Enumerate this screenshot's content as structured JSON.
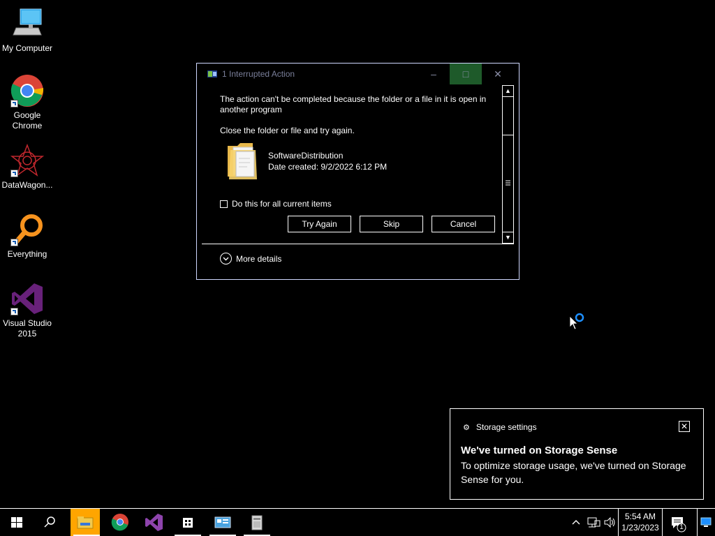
{
  "desktop": {
    "icons": [
      {
        "label": "My Computer"
      },
      {
        "label": "Google Chrome"
      },
      {
        "label": "DataWagon..."
      },
      {
        "label": "Everything"
      },
      {
        "label": "Visual Studio 2015"
      }
    ]
  },
  "dialog": {
    "title": "1 Interrupted Action",
    "message": "The action can't be completed because the folder or a file in it is open in another program",
    "instruction": "Close the folder or file and try again.",
    "file_name": "SoftwareDistribution",
    "file_date": "Date created: 9/2/2022 6:12 PM",
    "checkbox_label": "Do this for all current items",
    "checkbox_checked": false,
    "buttons": {
      "try_again": "Try Again",
      "skip": "Skip",
      "cancel": "Cancel"
    },
    "more_details": "More details"
  },
  "toast": {
    "header": "Storage settings",
    "title": "We've turned on Storage Sense",
    "body": "To optimize storage usage, we've turned on Storage Sense for you."
  },
  "taskbar": {
    "time": "5:54 AM",
    "date": "1/23/2023",
    "notification_count": "1",
    "items": [
      "start-icon",
      "search-icon",
      "file-explorer-icon",
      "chrome-icon",
      "visual-studio-icon",
      "store-icon",
      "control-panel-icon",
      "installer-icon"
    ]
  },
  "colors": {
    "background": "#000000",
    "text": "#ffffff",
    "accent_active": "#ffa500",
    "dialog_border": "#cfd8ff"
  }
}
